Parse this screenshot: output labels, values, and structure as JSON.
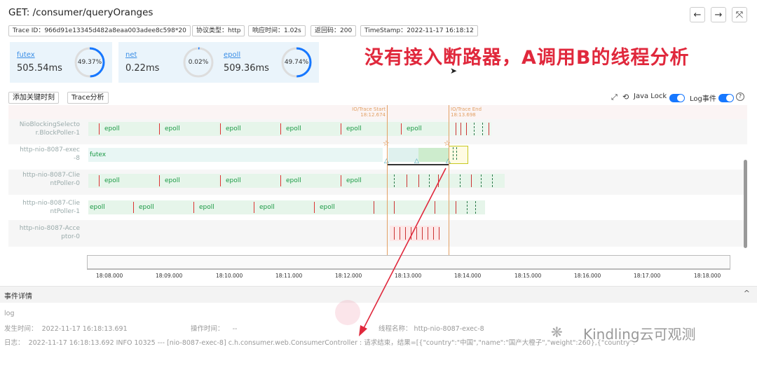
{
  "header": {
    "title": "GET: /consumer/queryOranges",
    "nav": {
      "back": "←",
      "forward": "→",
      "expand": "⤧"
    }
  },
  "tags": {
    "trace_id": "Trace ID：966d91e13345d482a8eaa003adee8c598*20",
    "protocol": "协议类型：http",
    "response_time": "响应时间：1.02s",
    "return_code": "返回码：200",
    "timestamp": "TimeStamp：2022-11-17 16:18:12"
  },
  "stats": [
    {
      "label": "futex",
      "value": "505.54ms",
      "percent": "49.37%",
      "fraction": 0.4937
    },
    {
      "label": "net",
      "value": "0.22ms",
      "percent": "0.02%",
      "fraction": 0.0002
    },
    {
      "label": "epoll",
      "value": "509.36ms",
      "percent": "49.74%",
      "fraction": 0.4974
    }
  ],
  "annotation": "没有接入断路器，A调用B的线程分析",
  "toolbar": {
    "add_key_time": "添加关键时刻",
    "trace_analysis": "Trace分析",
    "java_lock": "Java Lock",
    "log_event": "Log事件",
    "help_icon": "?"
  },
  "markers": {
    "start_label": "IO/Trace Start",
    "start_time": "18:12.674",
    "end_label": "IO/Trace End",
    "end_time": "18:13.698"
  },
  "lanes": [
    {
      "label_line1": "NioBlockingSelecto",
      "label_line2": "r.BlockPoller-1",
      "segment_text": "epoll"
    },
    {
      "label_line1": "http-nio-8087-exec",
      "label_line2": "-8",
      "segment_text": "futex"
    },
    {
      "label_line1": "http-nio-8087-Clie",
      "label_line2": "ntPoller-0",
      "segment_text": "epoll"
    },
    {
      "label_line1": "http-nio-8087-Clie",
      "label_line2": "ntPoller-1",
      "segment_text": "epoll"
    },
    {
      "label_line1": "http-nio-8087-Acce",
      "label_line2": "ptor-0",
      "segment_text": ""
    }
  ],
  "axis_ticks": [
    "18:08.000",
    "18:09.000",
    "18:10.000",
    "18:11.000",
    "18:12.000",
    "18:13.000",
    "18:14.000",
    "18:15.000",
    "18:16.000",
    "18:17.000",
    "18:18.000"
  ],
  "details": {
    "section_title": "事件详情",
    "collapse_icon": "^",
    "type": "log",
    "time_label": "发生时间：",
    "time_value": "2022-11-17 16:18:13.691",
    "op_label": "操作时间：",
    "op_value": "--",
    "thread_label": "线程名称：",
    "thread_value": "http-nio-8087-exec-8",
    "log_label": "日志：",
    "log_value": "2022-11-17 16:18:13.692 INFO 10325 --- [nio-8087-exec-8] c.h.consumer.web.ConsumerController : 请求结束，结果=[{\"country\":\"中国\",\"name\":\"国产大橙子\",\"weight\":260},{\"country\":"
  },
  "watermark": "Kindling云可观测",
  "colors": {
    "accent": "#1677ff",
    "annotation_red": "#e0283c",
    "segment_green": "#e6f5ea",
    "segment_text": "#1a9944",
    "marker": "#e2a064"
  }
}
